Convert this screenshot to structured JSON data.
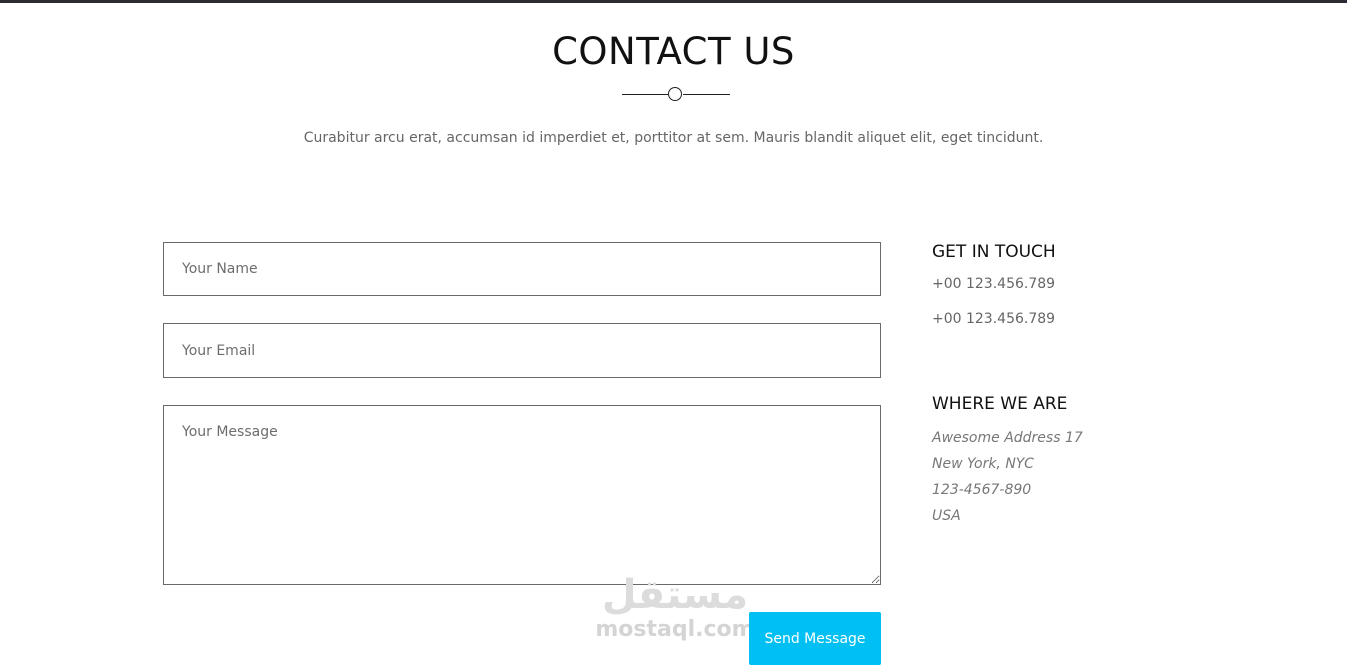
{
  "section": {
    "title": "CONTACT US",
    "subtitle": "Curabitur arcu erat, accumsan id imperdiet et, porttitor at sem. Mauris blandit aliquet elit, eget tincidunt."
  },
  "form": {
    "name_placeholder": "Your Name",
    "email_placeholder": "Your Email",
    "message_placeholder": "Your Message",
    "submit_label": "Send Message",
    "submit_color": "#00bff3"
  },
  "get_in_touch": {
    "heading": "GET IN TOUCH",
    "phones": [
      "+00 123.456.789",
      "+00 123.456.789"
    ]
  },
  "where_we_are": {
    "heading": "WHERE WE ARE",
    "lines": [
      "Awesome Address 17",
      "New York, NYC",
      "123-4567-890",
      "USA"
    ]
  },
  "watermark": {
    "arabic": "مستقل",
    "latin": "mostaql.com"
  }
}
